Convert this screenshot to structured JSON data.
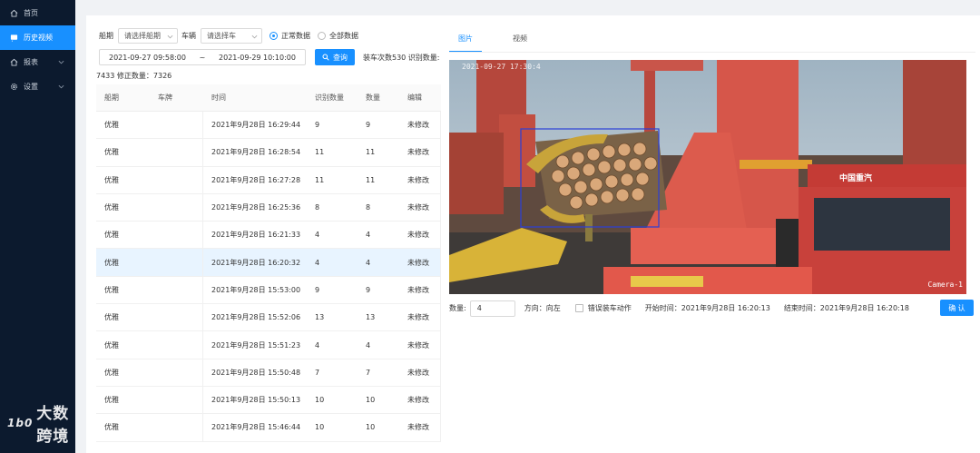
{
  "sidebar": {
    "items": [
      {
        "label": "首页",
        "icon": "home-icon",
        "active": false
      },
      {
        "label": "历史视频",
        "icon": "video-icon",
        "active": true
      },
      {
        "label": "报表",
        "icon": "report-icon",
        "active": false
      },
      {
        "label": "设置",
        "icon": "gear-icon",
        "active": false
      }
    ],
    "logo_text": "大数跨境",
    "logo_mark": "1b0"
  },
  "filters": {
    "ship_label": "船期",
    "ship_placeholder": "请选择船期",
    "car_label": "车辆",
    "car_placeholder": "请选择车",
    "radio_normal": "正常数据",
    "radio_all": "全部数据",
    "date_start": "2021-09-27 09:58:00",
    "date_sep": "~",
    "date_end": "2021-09-29 10:10:00",
    "query_label": "查询",
    "load_stats": "装车次数530 识别数量:"
  },
  "summary": "7433 修正数量：7326",
  "table": {
    "headers": [
      "船期",
      "车牌",
      "时间",
      "识别数量",
      "数量",
      "编辑"
    ],
    "rows": [
      {
        "ship": "优雅",
        "plate": "",
        "time": "2021年9月28日 16:29:44",
        "recognized": "9",
        "count": "9",
        "edit": "未修改"
      },
      {
        "ship": "优雅",
        "plate": "",
        "time": "2021年9月28日 16:28:54",
        "recognized": "11",
        "count": "11",
        "edit": "未修改"
      },
      {
        "ship": "优雅",
        "plate": "",
        "time": "2021年9月28日 16:27:28",
        "recognized": "11",
        "count": "11",
        "edit": "未修改"
      },
      {
        "ship": "优雅",
        "plate": "",
        "time": "2021年9月28日 16:25:36",
        "recognized": "8",
        "count": "8",
        "edit": "未修改"
      },
      {
        "ship": "优雅",
        "plate": "",
        "time": "2021年9月28日 16:21:33",
        "recognized": "4",
        "count": "4",
        "edit": "未修改"
      },
      {
        "ship": "优雅",
        "plate": "",
        "time": "2021年9月28日 16:20:32",
        "recognized": "4",
        "count": "4",
        "edit": "未修改"
      },
      {
        "ship": "优雅",
        "plate": "",
        "time": "2021年9月28日 15:53:00",
        "recognized": "9",
        "count": "9",
        "edit": "未修改"
      },
      {
        "ship": "优雅",
        "plate": "",
        "time": "2021年9月28日 15:52:06",
        "recognized": "13",
        "count": "13",
        "edit": "未修改"
      },
      {
        "ship": "优雅",
        "plate": "",
        "time": "2021年9月28日 15:51:23",
        "recognized": "4",
        "count": "4",
        "edit": "未修改"
      },
      {
        "ship": "优雅",
        "plate": "",
        "time": "2021年9月28日 15:50:48",
        "recognized": "7",
        "count": "7",
        "edit": "未修改"
      },
      {
        "ship": "优雅",
        "plate": "",
        "time": "2021年9月28日 15:50:13",
        "recognized": "10",
        "count": "10",
        "edit": "未修改"
      },
      {
        "ship": "优雅",
        "plate": "",
        "time": "2021年9月28日 15:46:44",
        "recognized": "10",
        "count": "10",
        "edit": "未修改"
      }
    ]
  },
  "viewer": {
    "tabs": [
      "图片",
      "视频"
    ],
    "camera_timestamp": "2021-09-27 17:30:4",
    "camera_label": "Camera-1",
    "truck_text": "中国重汽",
    "count_label": "数量:",
    "count_value": "4",
    "direction": "方向：向左",
    "misdetect_label": "错误装车动作",
    "start_time": "开始时间：2021年9月28日 16:20:13",
    "end_time": "结束时间：2021年9月28日 16:20:18",
    "confirm_label": "确 认"
  },
  "colors": {
    "sidebar_bg": "#0c1a2e",
    "accent": "#1890ff",
    "highlight_row": "#e8f4ff"
  }
}
